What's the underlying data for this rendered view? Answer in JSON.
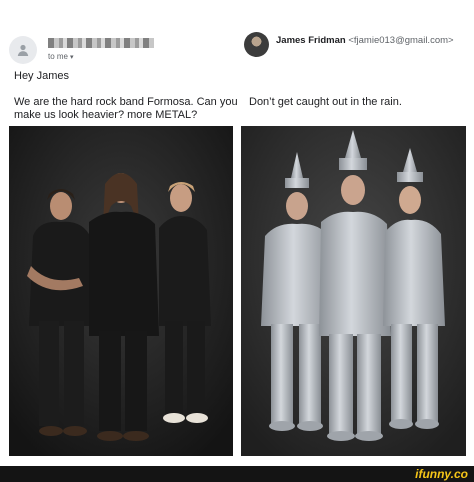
{
  "left_email": {
    "to_label": "to me",
    "greeting": "Hey James",
    "message": "We are the hard rock band Formosa. Can you make us look heavier? more METAL?"
  },
  "right_email": {
    "sender_name": "James Fridman",
    "sender_email": "<fjamie013@gmail.com>",
    "message": "Don’t get caught out in the rain."
  },
  "photos": {
    "left_icon": "band-photo-icon",
    "right_icon": "tin-man-costume-photo-icon"
  },
  "footer": {
    "watermark": "ifunny.co"
  },
  "colors": {
    "footer_bg": "#141414",
    "watermark": "#f5c518",
    "tin": "#b7bcc2"
  }
}
